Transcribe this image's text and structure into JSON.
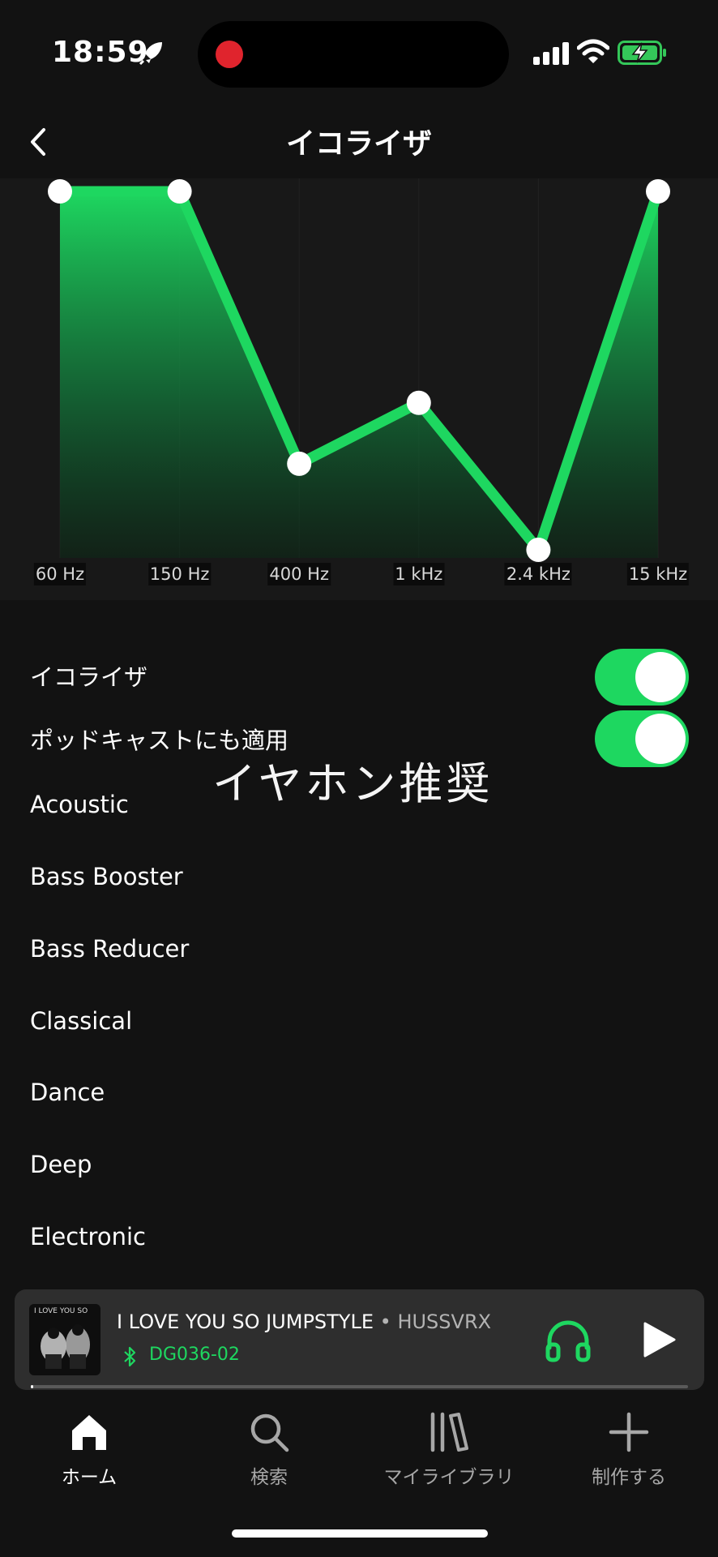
{
  "status_bar": {
    "time": "18:59"
  },
  "header": {
    "title": "イコライザ"
  },
  "equalizer": {
    "bands": [
      {
        "label": "60 Hz",
        "level": 1.0
      },
      {
        "label": "150 Hz",
        "level": 1.0
      },
      {
        "label": "400 Hz",
        "level": 0.24
      },
      {
        "label": "1 kHz",
        "level": 0.41
      },
      {
        "label": "2.4 kHz",
        "level": 0.0
      },
      {
        "label": "15 kHz",
        "level": 1.0
      }
    ],
    "accent_color": "#1ed760"
  },
  "toggles": {
    "equalizer_label": "イコライザ",
    "equalizer_on": true,
    "podcast_label": "ポッドキャストにも適用",
    "podcast_on": true
  },
  "overlay_text": "イヤホン推奨",
  "presets": [
    "Acoustic",
    "Bass Booster",
    "Bass Reducer",
    "Classical",
    "Dance",
    "Deep",
    "Electronic"
  ],
  "now_playing": {
    "title": "I LOVE YOU SO JUMPSTYLE",
    "separator": " • ",
    "artist": "HUSSVRX",
    "device": "DG036-02",
    "album_art_text": "I LOVE YOU SO",
    "progress": 0.004
  },
  "nav": {
    "items": [
      {
        "label": "ホーム",
        "icon": "home-icon",
        "active": true
      },
      {
        "label": "検索",
        "icon": "search-icon",
        "active": false
      },
      {
        "label": "マイライブラリ",
        "icon": "library-icon",
        "active": false
      },
      {
        "label": "制作する",
        "icon": "plus-icon",
        "active": false
      }
    ]
  }
}
